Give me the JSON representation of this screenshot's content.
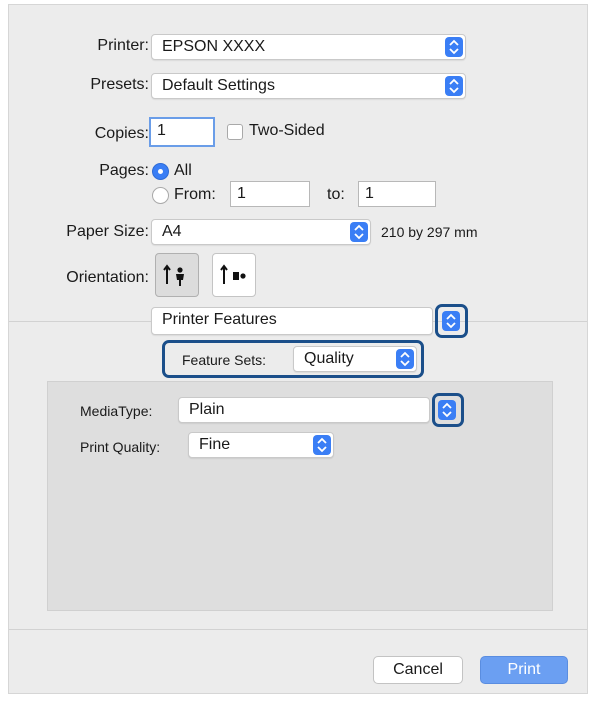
{
  "printer": {
    "label": "Printer:",
    "value": "EPSON XXXX"
  },
  "presets": {
    "label": "Presets:",
    "value": "Default Settings"
  },
  "copies": {
    "label": "Copies:",
    "value": "1",
    "two_sided_label": "Two-Sided"
  },
  "pages": {
    "label": "Pages:",
    "all_label": "All",
    "from_label": "From:",
    "from_value": "1",
    "to_label": "to:",
    "to_value": "1"
  },
  "paper_size": {
    "label": "Paper Size:",
    "value": "A4",
    "dimensions": "210 by 297 mm"
  },
  "orientation": {
    "label": "Orientation:"
  },
  "section_popup": {
    "value": "Printer Features"
  },
  "feature_sets": {
    "label": "Feature Sets:",
    "value": "Quality"
  },
  "media_type": {
    "label": "MediaType:",
    "value": "Plain"
  },
  "print_quality": {
    "label": "Print Quality:",
    "value": "Fine"
  },
  "buttons": {
    "cancel": "Cancel",
    "print": "Print"
  },
  "colors": {
    "accent": "#3a7ef5",
    "highlight": "#1b4f8a",
    "print_button": "#6b9ff2"
  },
  "icons": {
    "stepper": "up-down-chevron-icon",
    "portrait": "portrait-orientation-icon",
    "landscape": "landscape-orientation-icon"
  }
}
